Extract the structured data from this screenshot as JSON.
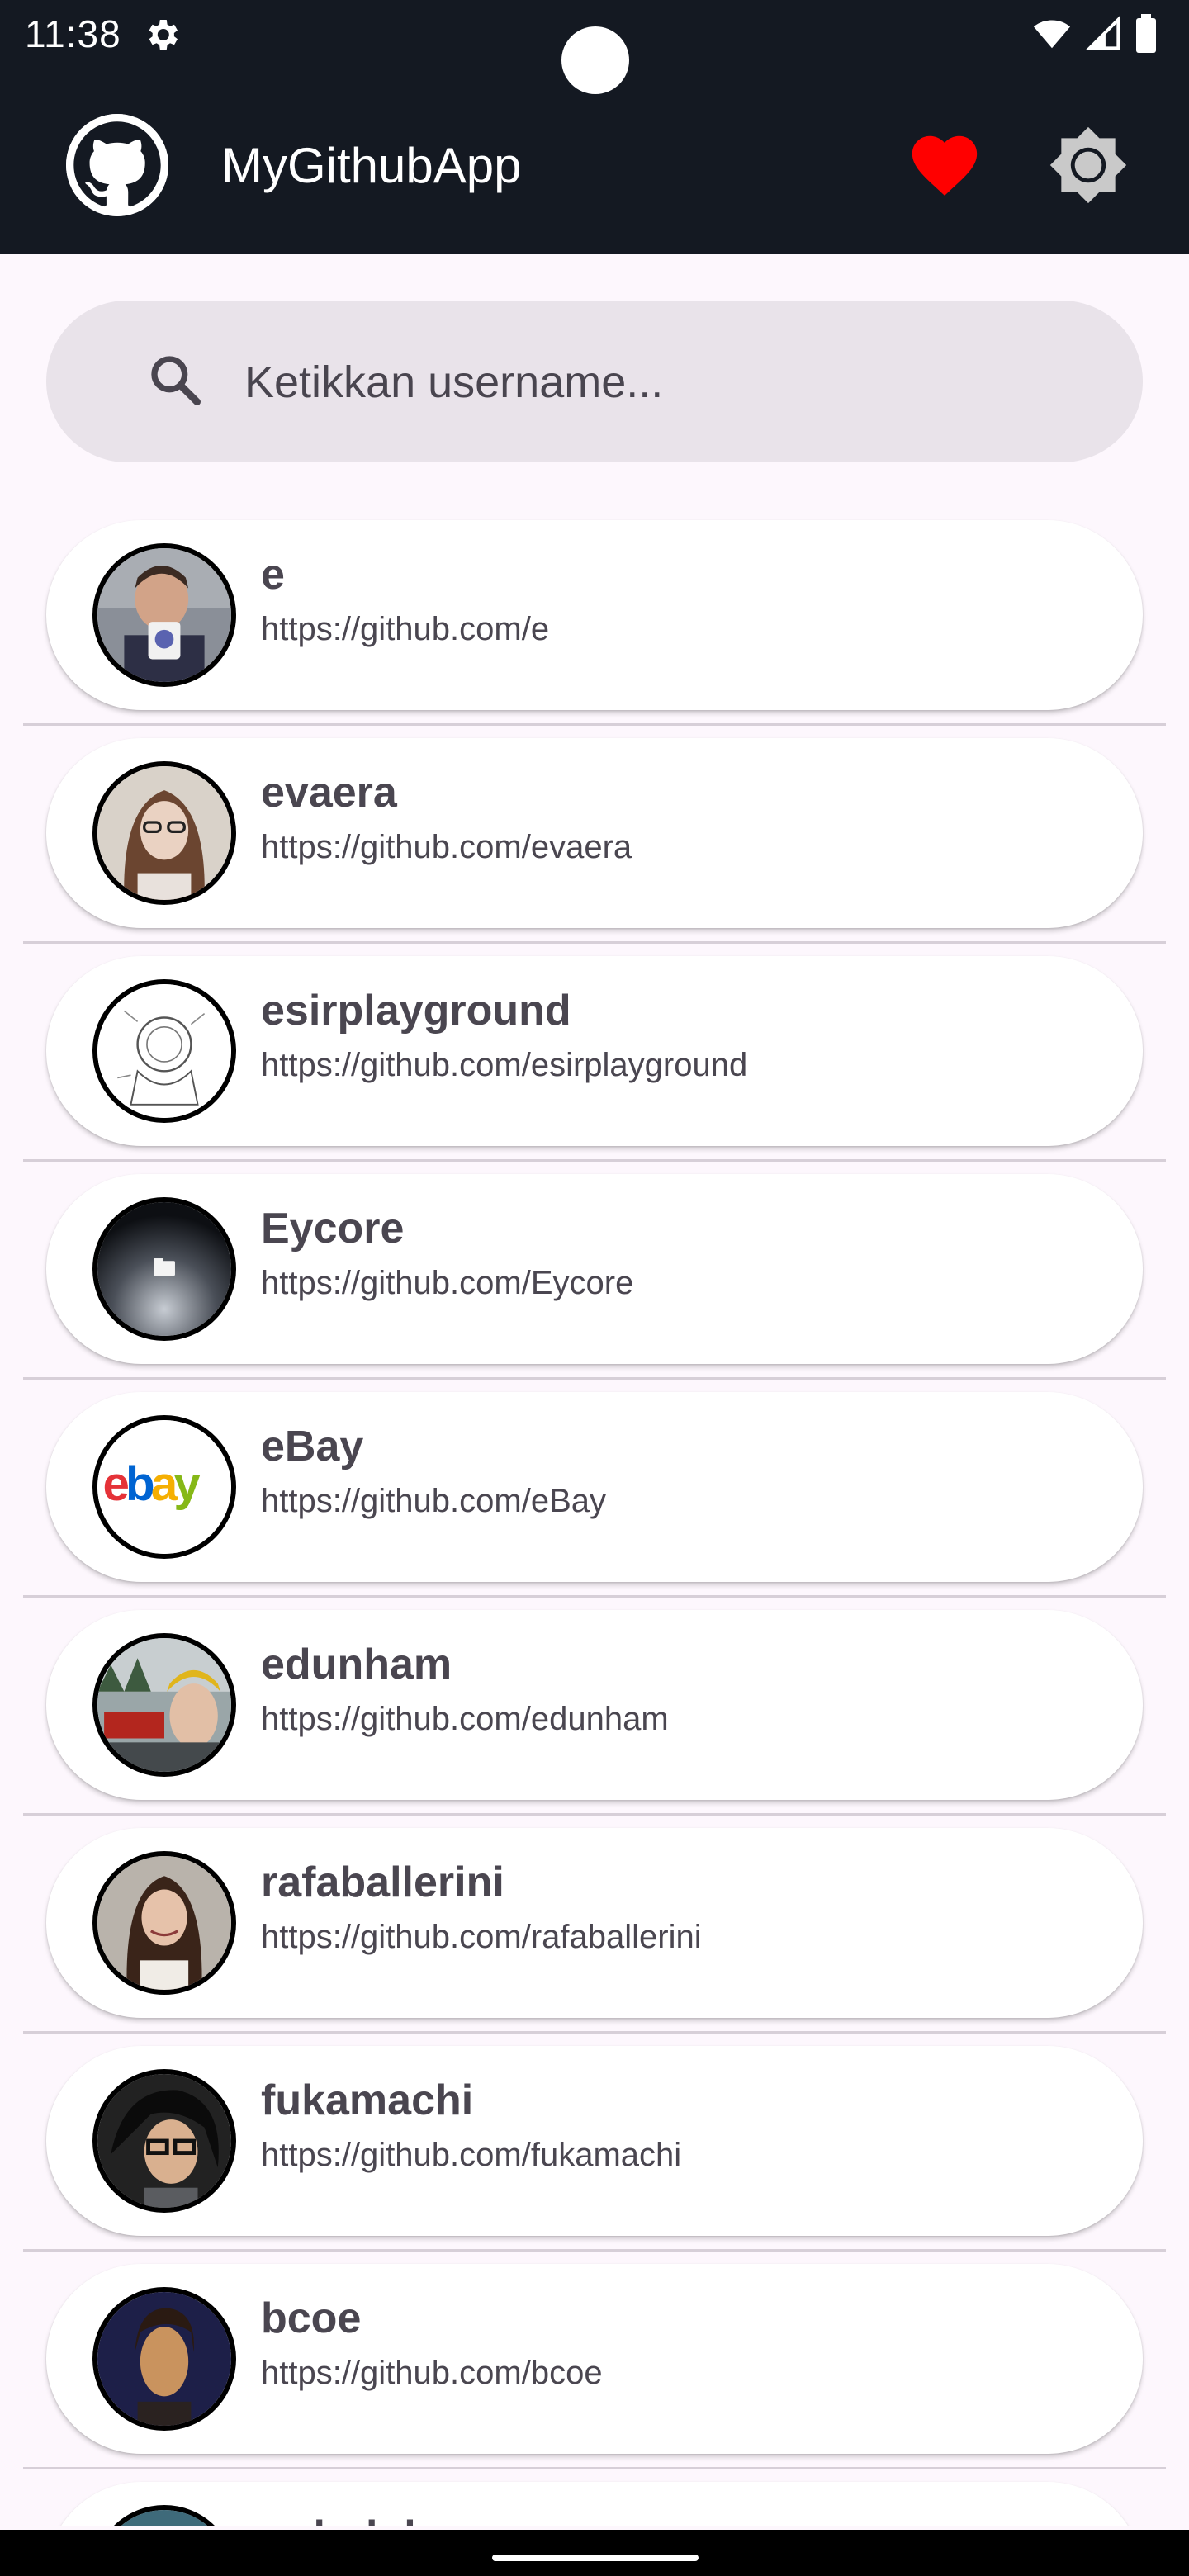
{
  "status_bar": {
    "time": "11:38"
  },
  "app_bar": {
    "title": "MyGithubApp",
    "logo_icon": "github-logo-icon",
    "favorite_icon": "heart-icon",
    "settings_icon": "brightness-icon"
  },
  "search": {
    "placeholder": "Ketikkan username...",
    "value": ""
  },
  "colors": {
    "app_bar": "#141922",
    "background": "#fdf7fd",
    "favorite": "#ff0000",
    "text": "#4a4650"
  },
  "users": [
    {
      "username": "e",
      "url": "https://github.com/e"
    },
    {
      "username": "evaera",
      "url": "https://github.com/evaera"
    },
    {
      "username": "esirplayground",
      "url": "https://github.com/esirplayground"
    },
    {
      "username": "Eycore",
      "url": "https://github.com/Eycore"
    },
    {
      "username": "eBay",
      "url": "https://github.com/eBay"
    },
    {
      "username": "edunham",
      "url": "https://github.com/edunham"
    },
    {
      "username": "rafaballerini",
      "url": "https://github.com/rafaballerini"
    },
    {
      "username": "fukamachi",
      "url": "https://github.com/fukamachi"
    },
    {
      "username": "bcoe",
      "url": "https://github.com/bcoe"
    },
    {
      "username": "gobolula",
      "url": ""
    }
  ],
  "ebay_logo": "ebay"
}
